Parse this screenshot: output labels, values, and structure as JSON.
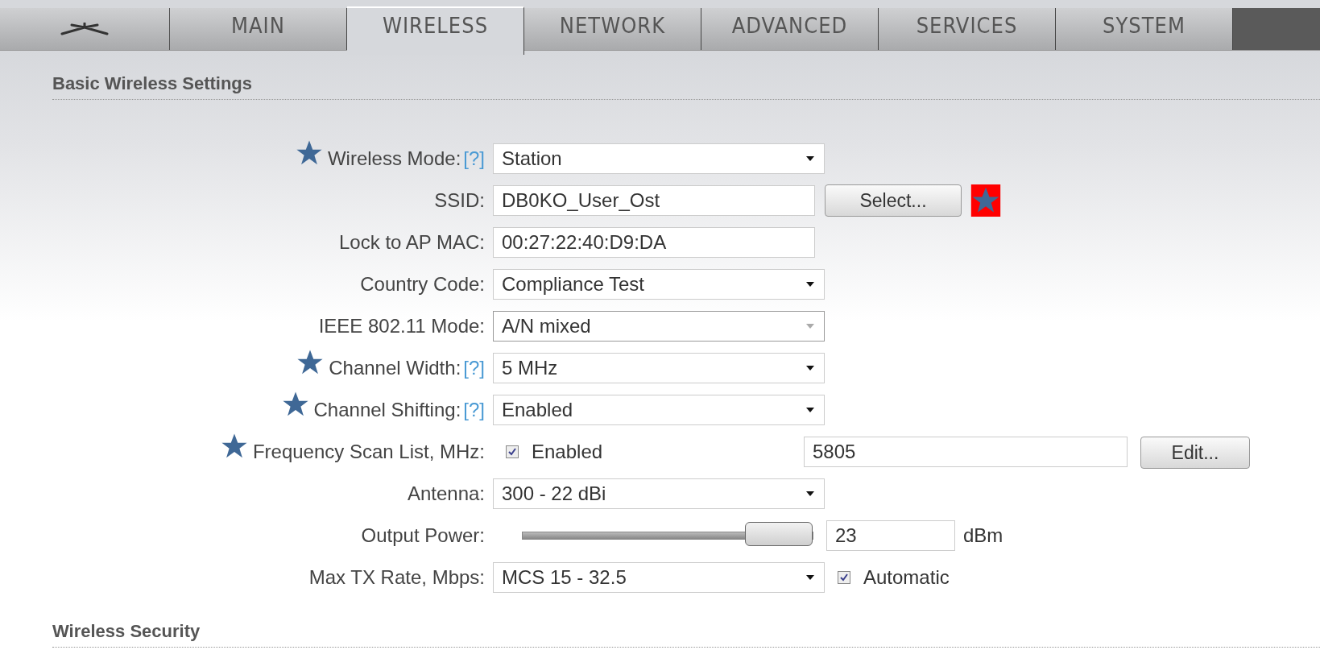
{
  "tabs": [
    {
      "label": "MAIN",
      "selected": false
    },
    {
      "label": "WIRELESS",
      "selected": true
    },
    {
      "label": "NETWORK",
      "selected": false
    },
    {
      "label": "ADVANCED",
      "selected": false
    },
    {
      "label": "SERVICES",
      "selected": false
    },
    {
      "label": "SYSTEM",
      "selected": false
    }
  ],
  "sections": [
    {
      "title": "Basic Wireless Settings",
      "rows": [
        {
          "kind": "select",
          "label": "Wireless Mode:",
          "help": "[?]",
          "starred": true,
          "value": "Station",
          "disabled": false
        },
        {
          "kind": "text_button",
          "label": "SSID:",
          "starred": false,
          "value": "DB0KO_User_Ost",
          "button": "Select...",
          "button_starred": true
        },
        {
          "kind": "text",
          "label": "Lock to AP MAC:",
          "starred": false,
          "value": "00:27:22:40:D9:DA"
        },
        {
          "kind": "select",
          "label": "Country Code:",
          "starred": false,
          "value": "Compliance Test",
          "disabled": false
        },
        {
          "kind": "select",
          "label": "IEEE 802.11 Mode:",
          "starred": false,
          "value": "A/N mixed",
          "disabled": true
        },
        {
          "kind": "select",
          "label": "Channel Width:",
          "help": "[?]",
          "starred": true,
          "value": "5 MHz",
          "disabled": false
        },
        {
          "kind": "select",
          "label": "Channel Shifting:",
          "help": "[?]",
          "starred": true,
          "value": "Enabled",
          "disabled": false
        },
        {
          "kind": "check_text_button",
          "label": "Frequency Scan List, MHz:",
          "starred": true,
          "checked": true,
          "check_label": "Enabled",
          "value": "5805",
          "button": "Edit..."
        },
        {
          "kind": "select",
          "label": "Antenna:",
          "starred": false,
          "value": "300 - 22 dBi",
          "disabled": false
        },
        {
          "kind": "slider",
          "label": "Output Power:",
          "starred": false,
          "level": 1,
          "value": "23",
          "unit": "dBm"
        },
        {
          "kind": "select_check",
          "label": "Max TX Rate, Mbps:",
          "starred": false,
          "value": "MCS 15 - 32.5",
          "disabled": false,
          "checked": true,
          "check_label": "Automatic"
        }
      ]
    },
    {
      "title": "Wireless Security"
    }
  ]
}
